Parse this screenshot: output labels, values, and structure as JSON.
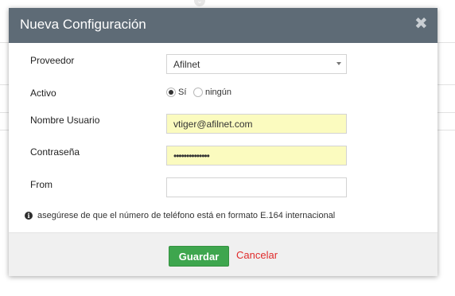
{
  "dialog": {
    "title": "Nueva Configuración",
    "close_symbol": "✖"
  },
  "fields": {
    "provider": {
      "label": "Proveedor",
      "value": "Afilnet"
    },
    "active": {
      "label": "Activo",
      "options": [
        {
          "label": "Sí",
          "selected": true
        },
        {
          "label": "ningún",
          "selected": false
        }
      ]
    },
    "username": {
      "label": "Nombre Usuario",
      "value": "vtiger@afilnet.com"
    },
    "password": {
      "label": "Contraseña",
      "value": "••••••••••••••"
    },
    "from": {
      "label": "From",
      "value": ""
    }
  },
  "info": {
    "icon": "info-icon",
    "glyph": "i",
    "text": "asegúrese de que el número de teléfono está en formato E.164 internacional"
  },
  "footer": {
    "save_label": "Guardar",
    "cancel_label": "Cancelar"
  },
  "colors": {
    "header_bg": "#5e6b76",
    "save_button": "#3ea64e",
    "cancel_link": "#e02b2b",
    "filled_input_bg": "#fbfbbf"
  }
}
